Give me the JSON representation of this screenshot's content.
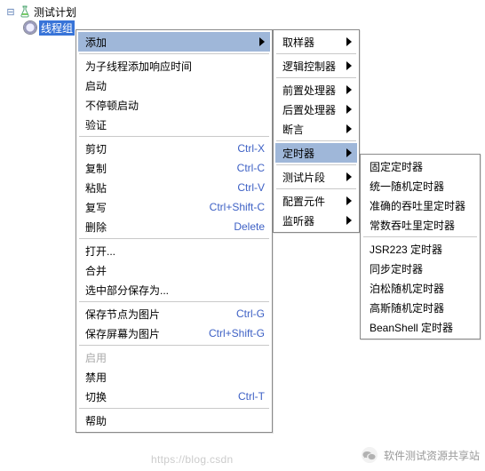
{
  "tree": {
    "root_label": "测试计划",
    "child_label": "线程组"
  },
  "menu1": {
    "add": "添加",
    "g1": [
      "为子线程添加响应时间",
      "启动",
      "不停顿启动",
      "验证"
    ],
    "g2": [
      {
        "l": "剪切",
        "s": "Ctrl-X"
      },
      {
        "l": "复制",
        "s": "Ctrl-C"
      },
      {
        "l": "粘贴",
        "s": "Ctrl-V"
      },
      {
        "l": "复写",
        "s": "Ctrl+Shift-C"
      },
      {
        "l": "删除",
        "s": "Delete"
      }
    ],
    "g3": [
      "打开...",
      "合并",
      "选中部分保存为..."
    ],
    "g4": [
      {
        "l": "保存节点为图片",
        "s": "Ctrl-G"
      },
      {
        "l": "保存屏幕为图片",
        "s": "Ctrl+Shift-G"
      }
    ],
    "enable": "启用",
    "disable": "禁用",
    "toggle": {
      "l": "切换",
      "s": "Ctrl-T"
    },
    "help": "帮助"
  },
  "menu2": [
    "取样器",
    "逻辑控制器",
    "前置处理器",
    "后置处理器",
    "断言",
    "定时器",
    "测试片段",
    "配置元件",
    "监听器"
  ],
  "menu3": [
    "固定定时器",
    "统一随机定时器",
    "准确的吞吐里定时器",
    "常数吞吐里定时器",
    "JSR223 定时器",
    "同步定时器",
    "泊松随机定时器",
    "高斯随机定时器",
    "BeanShell 定时器"
  ],
  "watermark": {
    "text": "软件测试资源共享站",
    "url": "https://blog.csdn"
  },
  "highlight_menu1": 0,
  "highlight_menu2": 5
}
